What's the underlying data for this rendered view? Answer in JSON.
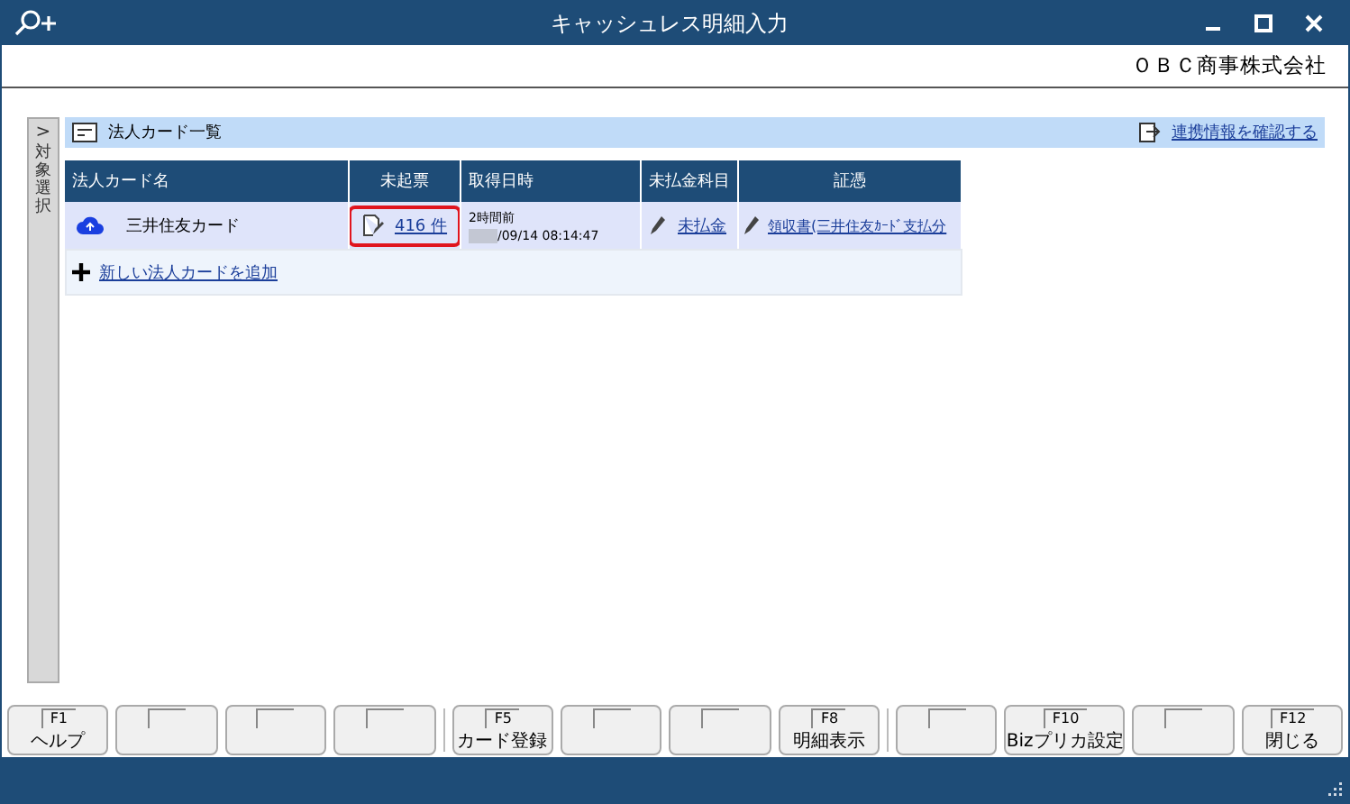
{
  "window": {
    "title": "キャッシュレス明細入力"
  },
  "company": "ＯＢＣ商事株式会社",
  "side_tab": {
    "arrow": ">",
    "label": "対象選択"
  },
  "panel": {
    "title": "法人カード一覧",
    "link": "連携情報を確認する"
  },
  "table": {
    "columns": [
      "法人カード名",
      "未起票",
      "取得日時",
      "未払金科目",
      "証憑"
    ],
    "rows": [
      {
        "name": "三井住友カード",
        "unposted": "416 件",
        "highlighted": true,
        "fetched_ago": "2時間前",
        "fetched_at": "/09/14 08:14:47",
        "redacted": true,
        "account": "未払金",
        "voucher": "領収書(三井住友ｶｰﾄﾞ支払分"
      }
    ],
    "add_link": "新しい法人カードを追加"
  },
  "function_keys": [
    {
      "kind": "assigned",
      "key": "F1",
      "label": "ヘルプ"
    },
    {
      "kind": "empty"
    },
    {
      "kind": "empty"
    },
    {
      "kind": "empty"
    },
    {
      "kind": "assigned",
      "key": "F5",
      "label": "カード登録"
    },
    {
      "kind": "empty"
    },
    {
      "kind": "empty"
    },
    {
      "kind": "assigned",
      "key": "F8",
      "label": "明細表示"
    },
    {
      "kind": "empty"
    },
    {
      "kind": "assigned",
      "key": "F10",
      "label": "Bizプリカ設定"
    },
    {
      "kind": "empty"
    },
    {
      "kind": "assigned",
      "key": "F12",
      "label": "閉じる"
    }
  ]
}
